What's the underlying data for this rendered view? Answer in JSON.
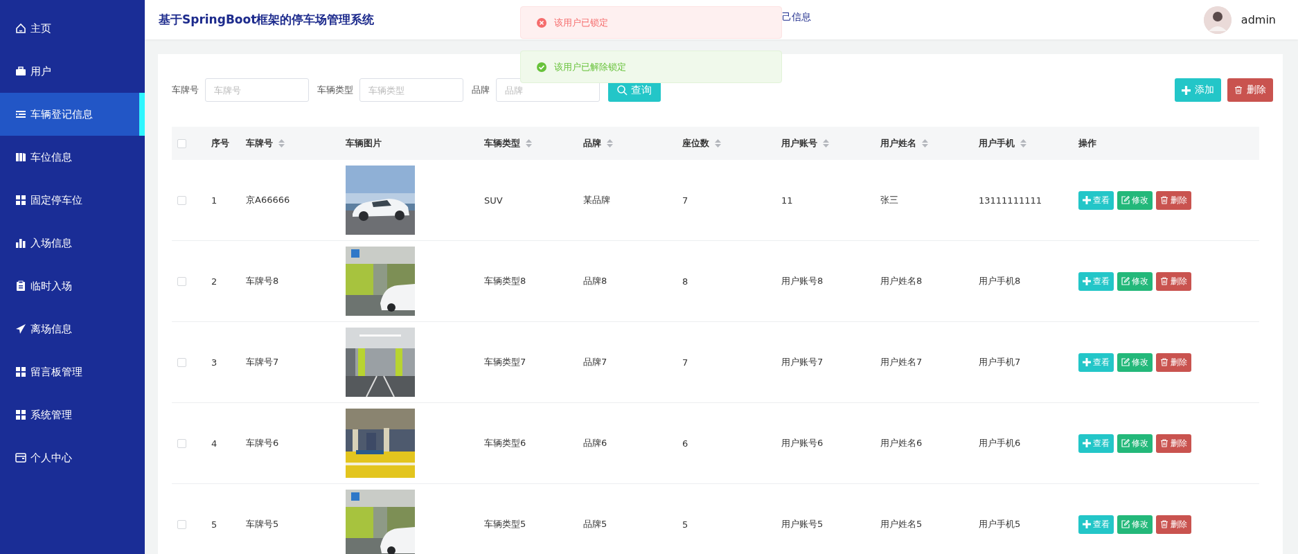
{
  "sidebar": {
    "items": [
      {
        "label": "主页",
        "selected": false
      },
      {
        "label": "用户",
        "selected": false
      },
      {
        "label": "车辆登记信息",
        "selected": true
      },
      {
        "label": "车位信息",
        "selected": false
      },
      {
        "label": "固定停车位",
        "selected": false
      },
      {
        "label": "入场信息",
        "selected": false
      },
      {
        "label": "临时入场",
        "selected": false
      },
      {
        "label": "离场信息",
        "selected": false
      },
      {
        "label": "留言板管理",
        "selected": false
      },
      {
        "label": "系统管理",
        "selected": false
      },
      {
        "label": "个人中心",
        "selected": false
      }
    ]
  },
  "header": {
    "title": "基于SpringBoot框架的停车场管理系统",
    "breadcrumb": "己信息",
    "user": "admin"
  },
  "toasts": [
    {
      "kind": "error",
      "message": "该用户已锁定"
    },
    {
      "kind": "success",
      "message": "该用户已解除锁定"
    }
  ],
  "search": {
    "fields": [
      {
        "label": "车牌号",
        "placeholder": "车牌号"
      },
      {
        "label": "车辆类型",
        "placeholder": "车辆类型"
      },
      {
        "label": "品牌",
        "placeholder": "品牌"
      }
    ],
    "button": "查询",
    "actions": [
      {
        "kind": "add",
        "label": "添加"
      },
      {
        "kind": "delete",
        "label": "删除"
      }
    ]
  },
  "table": {
    "select_all_checked": false,
    "columns": [
      {
        "label": "序号",
        "sortable": false
      },
      {
        "label": "车牌号",
        "sortable": true
      },
      {
        "label": "车辆图片",
        "sortable": false
      },
      {
        "label": "车辆类型",
        "sortable": true
      },
      {
        "label": "品牌",
        "sortable": true
      },
      {
        "label": "座位数",
        "sortable": true
      },
      {
        "label": "用户账号",
        "sortable": true
      },
      {
        "label": "用户姓名",
        "sortable": true
      },
      {
        "label": "用户手机",
        "sortable": true
      },
      {
        "label": "操作",
        "sortable": false
      }
    ],
    "rows": [
      {
        "checked": false,
        "cells": [
          "1",
          "京A66666",
          {
            "kind": "picture"
          },
          "SUV",
          "某品牌",
          "7",
          "11",
          "张三",
          "13111111111"
        ],
        "actions": [
          {
            "kind": "view",
            "label": "查看"
          },
          {
            "kind": "edit",
            "label": "修改"
          },
          {
            "kind": "delete",
            "label": "删除"
          }
        ]
      },
      {
        "checked": false,
        "cells": [
          "2",
          "车牌号8",
          {
            "kind": "picture"
          },
          "车辆类型8",
          "品牌8",
          "8",
          "用户账号8",
          "用户姓名8",
          "用户手机8"
        ],
        "actions": [
          {
            "kind": "view",
            "label": "查看"
          },
          {
            "kind": "edit",
            "label": "修改"
          },
          {
            "kind": "delete",
            "label": "删除"
          }
        ]
      },
      {
        "checked": false,
        "cells": [
          "3",
          "车牌号7",
          {
            "kind": "picture"
          },
          "车辆类型7",
          "品牌7",
          "7",
          "用户账号7",
          "用户姓名7",
          "用户手机7"
        ],
        "actions": [
          {
            "kind": "view",
            "label": "查看"
          },
          {
            "kind": "edit",
            "label": "修改"
          },
          {
            "kind": "delete",
            "label": "删除"
          }
        ]
      },
      {
        "checked": false,
        "cells": [
          "4",
          "车牌号6",
          {
            "kind": "picture"
          },
          "车辆类型6",
          "品牌6",
          "6",
          "用户账号6",
          "用户姓名6",
          "用户手机6"
        ],
        "actions": [
          {
            "kind": "view",
            "label": "查看"
          },
          {
            "kind": "edit",
            "label": "修改"
          },
          {
            "kind": "delete",
            "label": "删除"
          }
        ]
      },
      {
        "checked": false,
        "cells": [
          "5",
          "车牌号5",
          {
            "kind": "picture"
          },
          "车辆类型5",
          "品牌5",
          "5",
          "用户账号5",
          "用户姓名5",
          "用户手机5"
        ],
        "actions": [
          {
            "kind": "view",
            "label": "查看"
          },
          {
            "kind": "edit",
            "label": "修改"
          },
          {
            "kind": "delete",
            "label": "删除"
          }
        ]
      }
    ]
  }
}
